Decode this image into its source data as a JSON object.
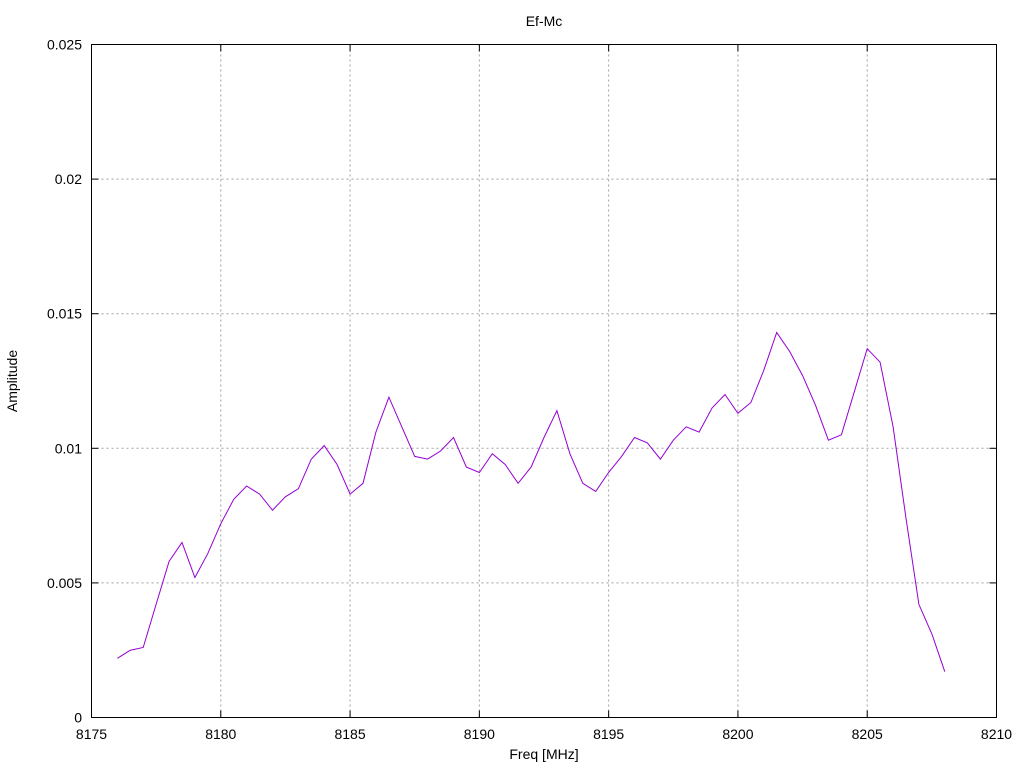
{
  "chart_data": {
    "type": "line",
    "title": "Ef-Mc",
    "xlabel": "Freq [MHz]",
    "ylabel": "Amplitude",
    "xlim": [
      8175,
      8210
    ],
    "ylim": [
      0,
      0.025
    ],
    "x_ticks": [
      8175,
      8180,
      8185,
      8190,
      8195,
      8200,
      8205,
      8210
    ],
    "x_tick_labels": [
      "8175",
      "8180",
      "8185",
      "8190",
      "8195",
      "8200",
      "8205",
      "8210"
    ],
    "y_ticks": [
      0,
      0.005,
      0.01,
      0.015,
      0.02,
      0.025
    ],
    "y_tick_labels": [
      "0",
      "0.005",
      "0.01",
      "0.015",
      "0.02",
      "0.025"
    ],
    "grid": true,
    "line_color": "#9400d3",
    "series": [
      {
        "x": [
          8176.0,
          8176.5,
          8177.0,
          8177.5,
          8178.0,
          8178.5,
          8179.0,
          8179.5,
          8180.0,
          8180.5,
          8181.0,
          8181.5,
          8182.0,
          8182.5,
          8183.0,
          8183.5,
          8184.0,
          8184.5,
          8185.0,
          8185.5,
          8186.0,
          8186.5,
          8187.0,
          8187.5,
          8188.0,
          8188.5,
          8189.0,
          8189.5,
          8190.0,
          8190.5,
          8191.0,
          8191.5,
          8192.0,
          8192.5,
          8193.0,
          8193.5,
          8194.0,
          8194.5,
          8195.0,
          8195.5,
          8196.0,
          8196.5,
          8197.0,
          8197.5,
          8198.0,
          8198.5,
          8199.0,
          8199.5,
          8200.0,
          8200.5,
          8201.0,
          8201.5,
          8202.0,
          8202.5,
          8203.0,
          8203.5,
          8204.0,
          8204.5,
          8205.0,
          8205.5,
          8206.0,
          8206.5,
          8207.0,
          8207.5,
          8208.0
        ],
        "y": [
          0.0022,
          0.0025,
          0.0026,
          0.0042,
          0.0058,
          0.0065,
          0.0052,
          0.0061,
          0.0072,
          0.0081,
          0.0086,
          0.0083,
          0.0077,
          0.0082,
          0.0085,
          0.0096,
          0.0101,
          0.0094,
          0.0083,
          0.0087,
          0.0106,
          0.0119,
          0.0108,
          0.0097,
          0.0096,
          0.0099,
          0.0104,
          0.0093,
          0.0091,
          0.0098,
          0.0094,
          0.0087,
          0.0093,
          0.0104,
          0.0114,
          0.0098,
          0.0087,
          0.0084,
          0.0091,
          0.0097,
          0.0104,
          0.0102,
          0.0096,
          0.0103,
          0.0108,
          0.0106,
          0.0115,
          0.012,
          0.0113,
          0.0117,
          0.0129,
          0.0143,
          0.0136,
          0.0127,
          0.0116,
          0.0103,
          0.0105,
          0.0121,
          0.0137,
          0.0132,
          0.0108,
          0.0074,
          0.0042,
          0.0031,
          0.0017
        ]
      }
    ]
  }
}
